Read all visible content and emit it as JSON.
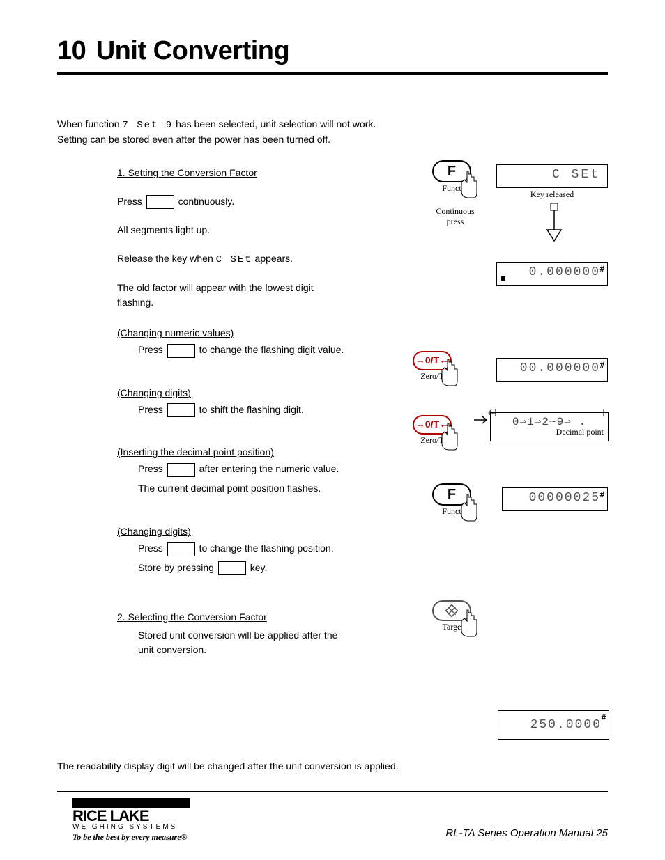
{
  "header": {
    "number": "10",
    "title": "Unit Converting"
  },
  "intro": {
    "line1_prefix": "When function ",
    "line1_code": "7 Set 9",
    "line1_suffix": " has been selected, unit selection will not work.",
    "line2": "Setting can be stored even after the power has been turned off."
  },
  "step1": {
    "heading": "1. Setting the Conversion Factor",
    "p1_prefix": "Press ",
    "p1_suffix": " continuously.",
    "p2": "All segments light up.",
    "p3_prefix": "Release the key when ",
    "p3_code": "C SEt",
    "p3_suffix": " appears.",
    "p4": "The old factor will appear with the lowest digit flashing."
  },
  "step_numeric": {
    "h1": "(Changing numeric values)",
    "h1_body_a": "Press ",
    "h1_body_b": " to change the flashing digit value.",
    "h2": "(Changing digits)",
    "h2_body_a": "Press ",
    "h2_body_b": " to shift the flashing digit.",
    "h3": "(Inserting the decimal point position)",
    "h3_body_a": "Press ",
    "h3_body_b": " after entering the numeric value.",
    "h3_body_c": "The current decimal point position flashes.",
    "h4": "(Changing digits)",
    "h4_body_a": "Press ",
    "h4_body_b": " to change the flashing position.",
    "h4_body_c_a": "Store by pressing ",
    "h4_body_c_b": " key.",
    "h5": "2. Selecting the Conversion Factor",
    "h5_body": "Stored unit conversion will be applied after the unit conversion.",
    "note": "The readability display digit will be changed after the unit conversion is applied."
  },
  "right": {
    "continuous_press": "Continuous\npress",
    "key_released": "Key released",
    "decimal_point": "Decimal point",
    "digits_seq": "0⇒1⇒2∼9⇒ .",
    "lcd1": "C SEt",
    "lcd2": "0.000000",
    "lcd3": "00.000000",
    "lcd4": "00000025",
    "lcd5": "250.0000",
    "btn_f_label": "Funct",
    "btn_zt_face": "→0/T←",
    "btn_zt_label": "Zero/T",
    "btn_target_label": "Targe",
    "btn_f_face": "F"
  },
  "footer": {
    "brand_top": "RICE LAKE",
    "brand_sub": "WEIGHING SYSTEMS",
    "brand_tag": "To be the best by every measure®",
    "right": "RL-TA Series Operation Manual  25"
  }
}
